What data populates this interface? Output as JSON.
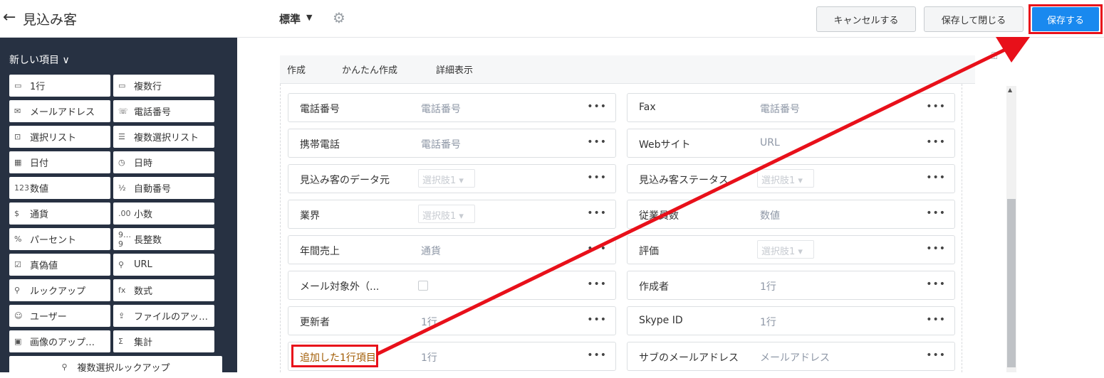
{
  "header": {
    "back_glyph": "←",
    "title": "見込み客",
    "layout_name": "標準",
    "cancel_label": "キャンセルする",
    "save_close_label": "保存して閉じる",
    "save_label": "保存する"
  },
  "sidebar": {
    "heading": "新しい項目 ∨",
    "items": [
      {
        "icon": "▭",
        "label": "1行"
      },
      {
        "icon": "▭",
        "label": "複数行"
      },
      {
        "icon": "✉",
        "label": "メールアドレス"
      },
      {
        "icon": "☏",
        "label": "電話番号"
      },
      {
        "icon": "⊡",
        "label": "選択リスト"
      },
      {
        "icon": "☰",
        "label": "複数選択リスト"
      },
      {
        "icon": "▦",
        "label": "日付"
      },
      {
        "icon": "◷",
        "label": "日時"
      },
      {
        "icon": "123",
        "label": "数値"
      },
      {
        "icon": "½",
        "label": "自動番号"
      },
      {
        "icon": "$",
        "label": "通貨"
      },
      {
        "icon": ".00",
        "label": "小数"
      },
      {
        "icon": "%",
        "label": "パーセント"
      },
      {
        "icon": "9…9",
        "label": "長整数"
      },
      {
        "icon": "☑",
        "label": "真偽値"
      },
      {
        "icon": "⚲",
        "label": "URL"
      },
      {
        "icon": "⚲",
        "label": "ルックアップ"
      },
      {
        "icon": "fx",
        "label": "数式"
      },
      {
        "icon": "☺",
        "label": "ユーザー"
      },
      {
        "icon": "⇪",
        "label": "ファイルのアッ…"
      },
      {
        "icon": "▣",
        "label": "画像のアップ…"
      },
      {
        "icon": "Σ",
        "label": "集計"
      },
      {
        "icon": "⚲",
        "label": "複数選択ルックアップ"
      }
    ]
  },
  "tabs": [
    "作成",
    "かんたん作成",
    "詳細表示"
  ],
  "fields": {
    "left": [
      {
        "label": "電話番号",
        "type": "text",
        "placeholder": "電話番号"
      },
      {
        "label": "携帯電話",
        "type": "text",
        "placeholder": "電話番号"
      },
      {
        "label": "見込み客のデータ元",
        "type": "select",
        "placeholder": "選択肢1 ▾"
      },
      {
        "label": "業界",
        "type": "select",
        "placeholder": "選択肢1 ▾"
      },
      {
        "label": "年間売上",
        "type": "text",
        "placeholder": "通貨"
      },
      {
        "label": "メール対象外（...",
        "type": "checkbox",
        "placeholder": ""
      },
      {
        "label": "更新者",
        "type": "text",
        "placeholder": "1行"
      },
      {
        "label": "追加した1行項目",
        "type": "text",
        "placeholder": "1行"
      }
    ],
    "right": [
      {
        "label": "Fax",
        "type": "text",
        "placeholder": "電話番号"
      },
      {
        "label": "Webサイト",
        "type": "text",
        "placeholder": "URL"
      },
      {
        "label": "見込み客ステータス",
        "type": "select",
        "placeholder": "選択肢1 ▾"
      },
      {
        "label": "従業員数",
        "type": "text",
        "placeholder": "数値"
      },
      {
        "label": "評価",
        "type": "select",
        "placeholder": "選択肢1 ▾"
      },
      {
        "label": "作成者",
        "type": "text",
        "placeholder": "1行"
      },
      {
        "label": "Skype ID",
        "type": "text",
        "placeholder": "1行"
      },
      {
        "label": "サブのメールアドレス",
        "type": "text",
        "placeholder": "メールアドレス"
      }
    ],
    "more_glyph": "•••"
  },
  "colors": {
    "sidebar_bg": "#273142",
    "primary_button": "#1989ef",
    "annotation_red": "#e8101a"
  }
}
